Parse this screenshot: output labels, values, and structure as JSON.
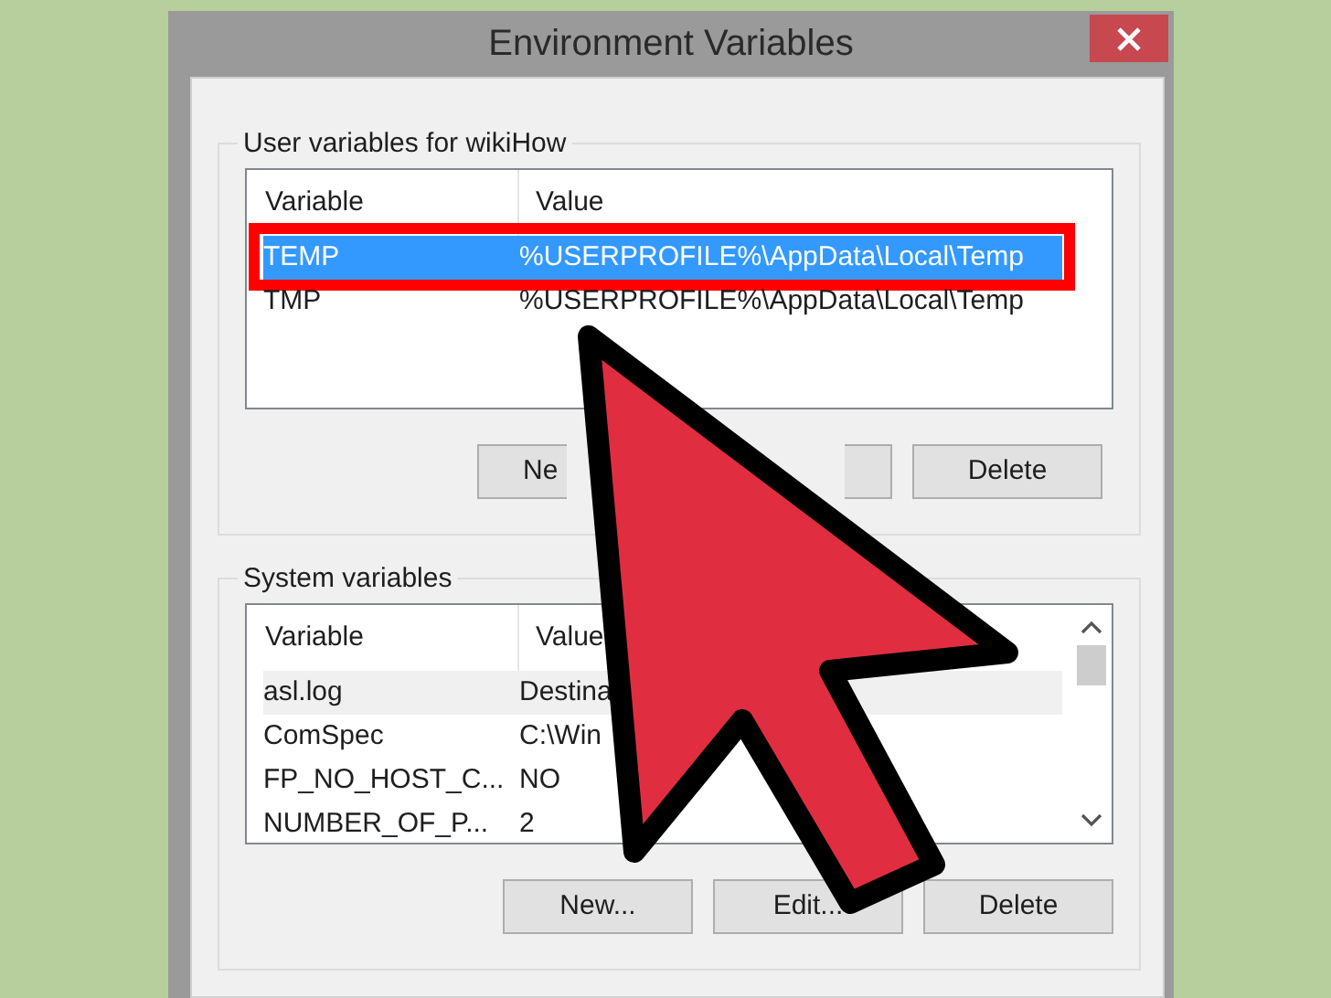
{
  "window": {
    "title": "Environment Variables"
  },
  "user_variables": {
    "label": "User variables for wikiHow",
    "focused": true,
    "columns": [
      "Variable",
      "Value"
    ],
    "rows": [
      {
        "variable": "TEMP",
        "value": "%USERPROFILE%\\AppData\\Local\\Temp",
        "selected": true,
        "annotated": true
      },
      {
        "variable": "TMP",
        "value": "%USERPROFILE%\\AppData\\Local\\Temp",
        "selected": false,
        "annotated": false
      }
    ],
    "buttons": [
      {
        "label": "Ne",
        "kind": "left-part"
      },
      {
        "kind": "right-part"
      },
      {
        "label": "Delete",
        "kind": "whole"
      }
    ]
  },
  "system_variables": {
    "label": "System variables",
    "focused": false,
    "columns": [
      "Variable",
      "Value"
    ],
    "rows": [
      {
        "variable": "asl.log",
        "value": "Destina",
        "selected": true,
        "annotated": false
      },
      {
        "variable": "ComSpec",
        "value": "C:\\Win",
        "selected": false,
        "annotated": false
      },
      {
        "variable": "FP_NO_HOST_C...",
        "value": "NO",
        "selected": false,
        "annotated": false
      },
      {
        "variable": "NUMBER_OF_P...",
        "value": "2",
        "selected": false,
        "annotated": false
      }
    ],
    "buttons": [
      {
        "label": "New...",
        "kind": "whole"
      },
      {
        "label": "Edit...",
        "kind": "whole"
      },
      {
        "label": "Delete",
        "kind": "whole"
      }
    ]
  },
  "annotation": {
    "kind": "arrow"
  }
}
